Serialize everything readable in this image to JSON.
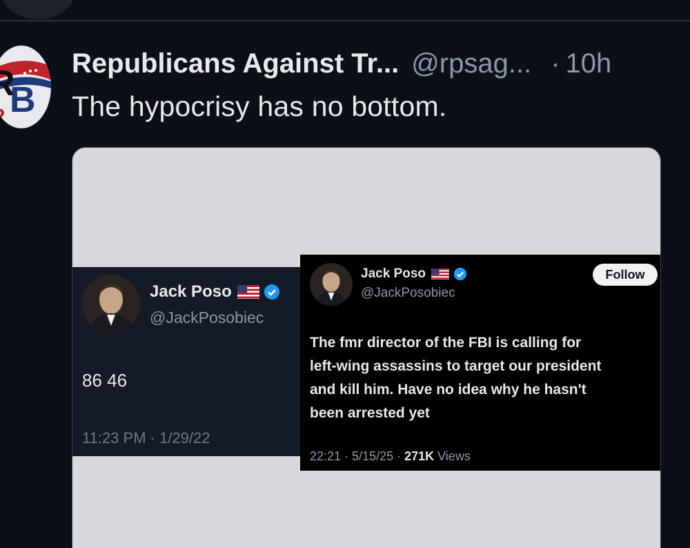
{
  "previous_tweet": {},
  "tweet": {
    "author": {
      "display_name": "Republicans Against Tr...",
      "handle": "@rpsag...",
      "avatar_letters": "RB"
    },
    "separator_dot": "·",
    "time_ago": "10h",
    "text": "The hypocrisy has no bottom.",
    "media": {
      "left_screenshot": {
        "name": "Jack Poso",
        "handle": "@JackPosobiec",
        "body": "86 46",
        "timestamp": "11:23 PM · 1/29/22"
      },
      "right_screenshot": {
        "name": "Jack Poso",
        "handle": "@JackPosobiec",
        "follow_label": "Follow",
        "body_lines": [
          "The fmr director of the FBI is calling for",
          "left-wing assassins to target our president",
          "and kill him. Have no idea why he hasn't",
          "been arrested yet"
        ],
        "footer_prefix": "22:21 · 5/15/25 · ",
        "views_count": "271K",
        "views_label": " Views"
      }
    }
  },
  "icons": {
    "flag": "us-flag-icon",
    "verified": "verified-badge-icon"
  },
  "colors": {
    "background": "#0b0f17",
    "text_primary": "#e7e9ea",
    "text_secondary": "#8b98a5",
    "verified_blue": "#1d9bf0",
    "media_background": "#d8d8dc"
  }
}
